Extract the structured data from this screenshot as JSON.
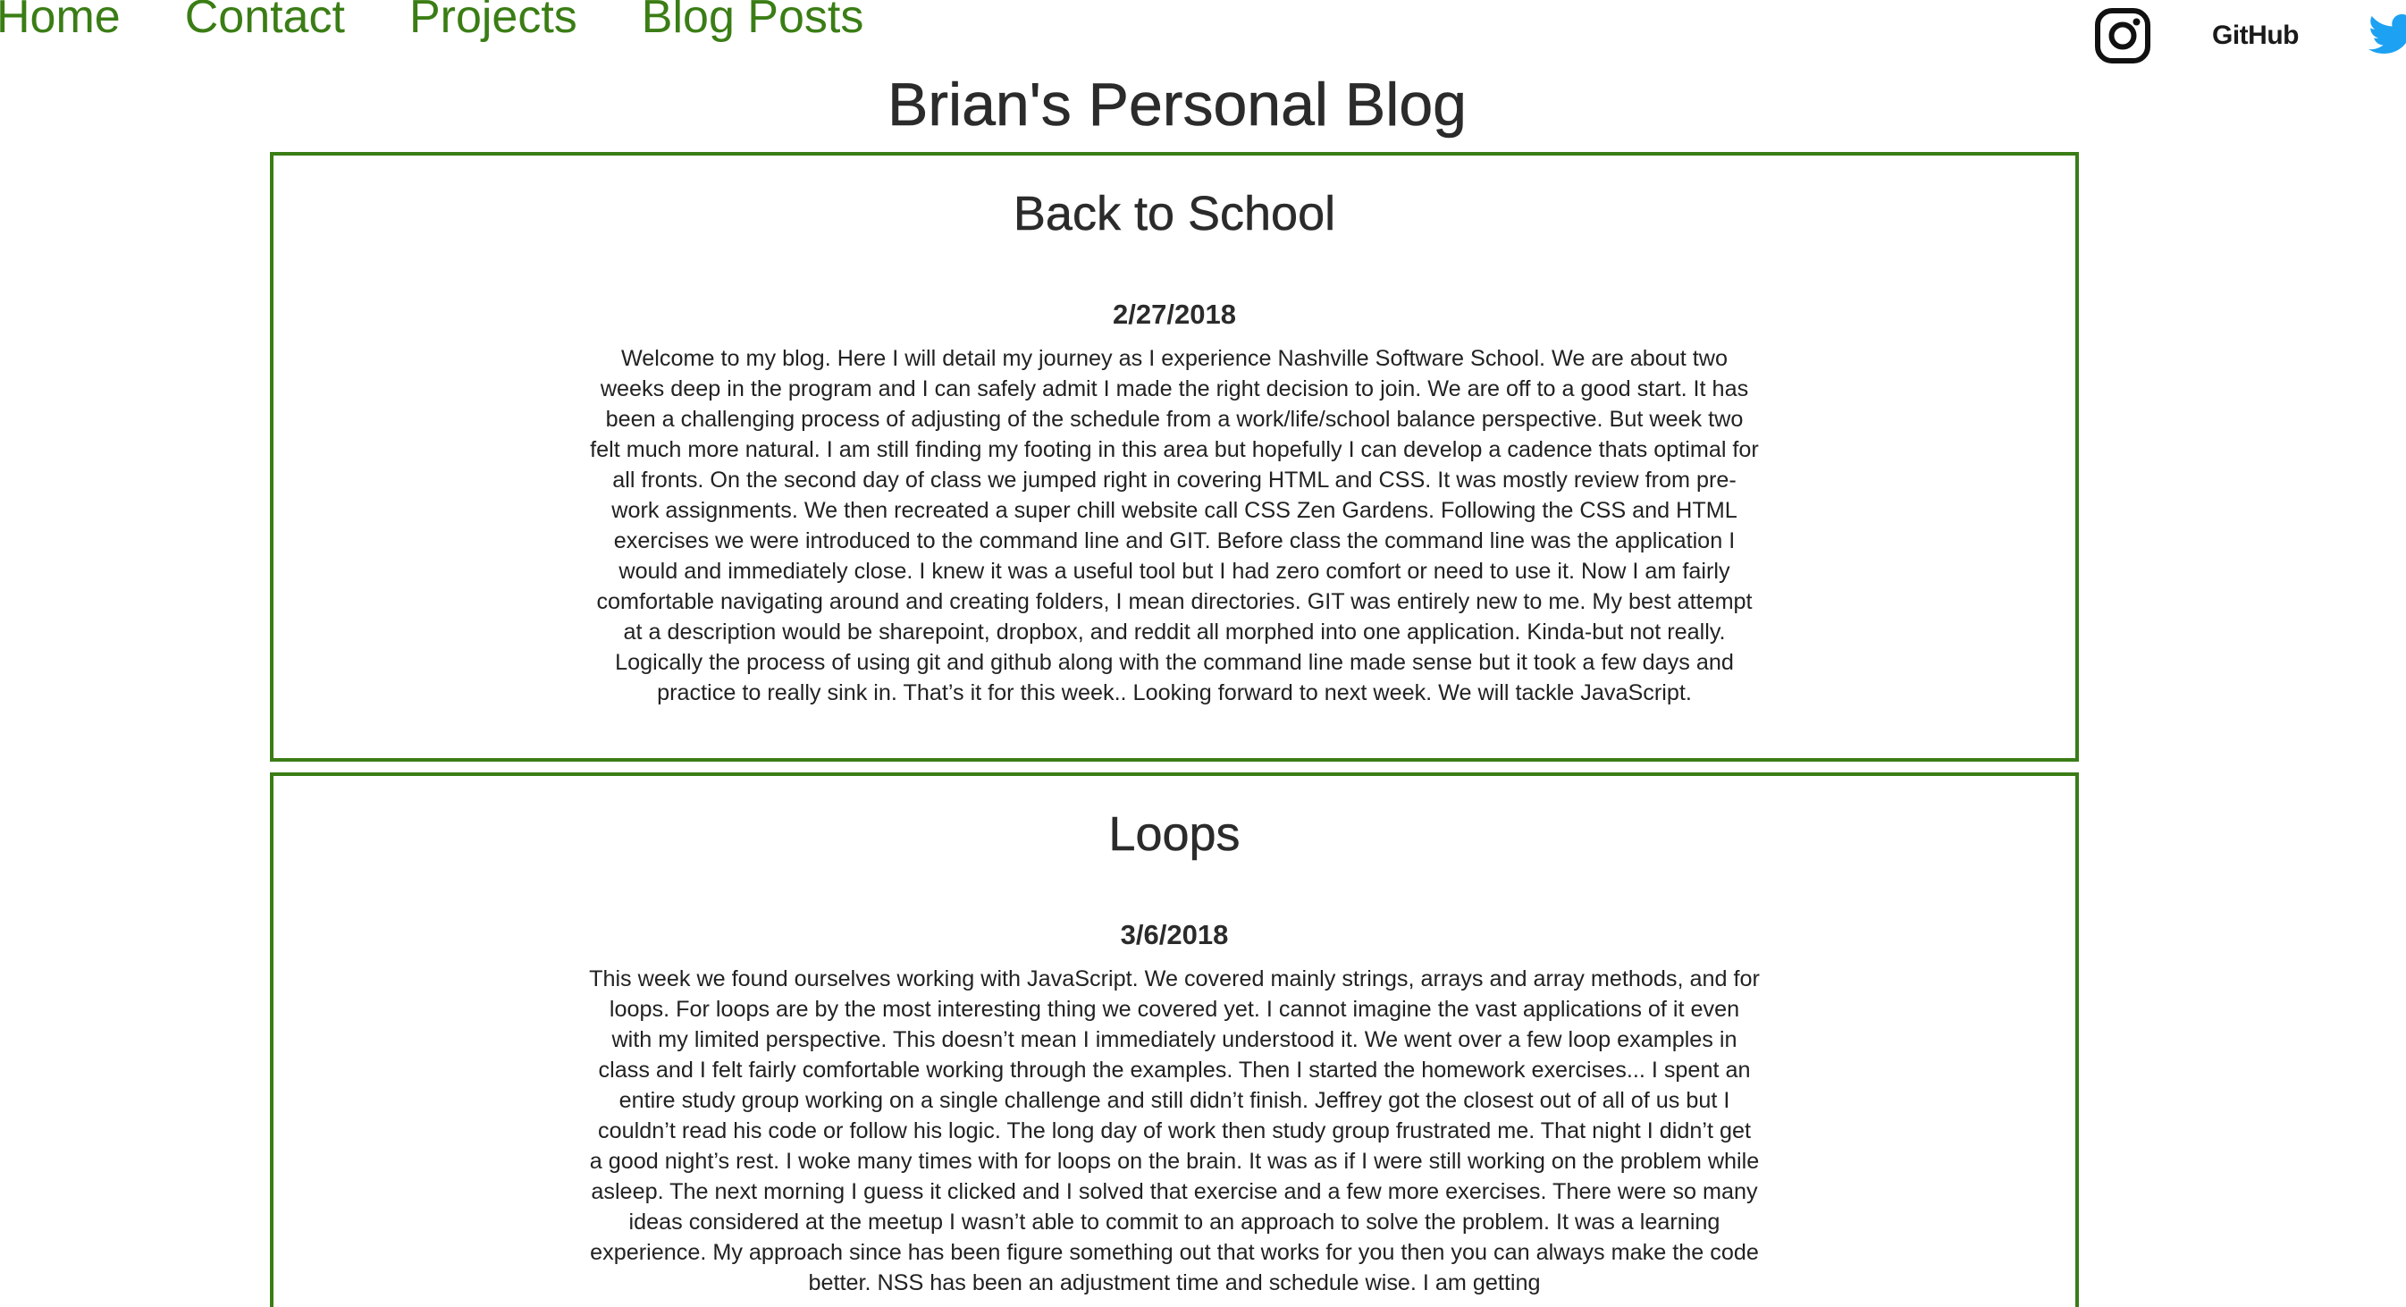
{
  "nav": {
    "home": "Home",
    "contact": "Contact",
    "projects": "Projects",
    "blog_posts": "Blog Posts"
  },
  "social": {
    "instagram_icon": "instagram-icon",
    "github_label": "GitHub",
    "twitter_icon": "twitter-icon"
  },
  "site_title": "Brian's Personal Blog",
  "posts": [
    {
      "title": "Back to School",
      "date": "2/27/2018",
      "body": "Welcome to my blog. Here I will detail my journey as I experience Nashville Software School. We are about two weeks deep in the program and I can safely admit I made the right decision to join. We are off to a good start. It has been a challenging process of adjusting of the schedule from a work/life/school balance perspective. But week two felt much more natural. I am still finding my footing in this area but hopefully I can develop a cadence thats optimal for all fronts. On the second day of class we jumped right in covering HTML and CSS. It was mostly review from pre-work assignments. We then recreated a super chill website call CSS Zen Gardens. Following the CSS and HTML exercises we were introduced to the command line and GIT. Before class the command line was the application I would and immediately close. I knew it was a useful tool but I had zero comfort or need to use it. Now I am fairly comfortable navigating around and creating folders, I mean directories. GIT was entirely new to me. My best attempt at a description would be sharepoint, dropbox, and reddit all morphed into one application. Kinda-but not really. Logically the process of using git and github along with the command line made sense but it took a few days and practice to really sink in. That’s it for this week.. Looking forward to next week. We will tackle JavaScript."
    },
    {
      "title": "Loops",
      "date": "3/6/2018",
      "body": "This week we found ourselves working with JavaScript. We covered mainly strings, arrays and array methods, and for loops. For loops are by the most interesting thing we covered yet. I cannot imagine the vast applications of it even with my limited perspective. This doesn’t mean I immediately understood it. We went over a few loop examples in class and I felt fairly comfortable working through the examples. Then I started the homework exercises... I spent an entire study group working on a single challenge and still didn’t finish. Jeffrey got the closest out of all of us but I couldn’t read his code or follow his logic. The long day of work then study group frustrated me. That night I didn’t get a good night’s rest. I woke many times with for loops on the brain. It was as if I were still working on the problem while asleep. The next morning I guess it clicked and I solved that exercise and a few more exercises. There were so many ideas considered at the meetup I wasn’t able to commit to an approach to solve the problem. It was a learning experience. My approach since has been figure something out that works for you then you can always make the code better. NSS has been an adjustment time and schedule wise. I am getting"
    }
  ],
  "colors": {
    "accent": "#3a7d15",
    "text": "#222222",
    "twitter": "#1da1f2"
  }
}
